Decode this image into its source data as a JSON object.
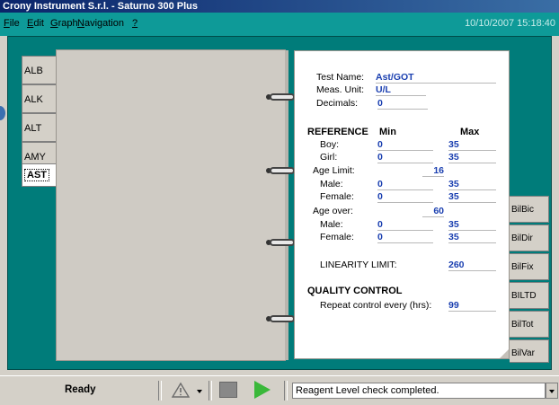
{
  "window": {
    "title": "Crony Instrument S.r.l. - Saturno 300 Plus",
    "datetime": "10/10/2007  15:18:40"
  },
  "menu": [
    {
      "label": "File",
      "key": "F"
    },
    {
      "label": "Edit",
      "key": "E"
    },
    {
      "label": "Graph",
      "key": "G"
    },
    {
      "label": "Navigation",
      "key": "N"
    },
    {
      "label": "?",
      "key": "?"
    }
  ],
  "left_tabs": [
    "ALB",
    "ALK",
    "ALT",
    "AMY",
    "AST"
  ],
  "active_tab": "AST",
  "right_tabs": [
    "BilBic",
    "BilDir",
    "BilFix",
    "BILTD",
    "BilTot",
    "BilVar"
  ],
  "form": {
    "test_name_label": "Test Name:",
    "test_name": "Ast/GOT",
    "unit_label": "Meas. Unit:",
    "unit": "U/L",
    "decimals_label": "Decimals:",
    "decimals": "0",
    "reference_header": "REFERENCE",
    "min_header": "Min",
    "max_header": "Max",
    "boy_label": "Boy:",
    "boy_min": "0",
    "boy_max": "35",
    "girl_label": "Girl:",
    "girl_min": "0",
    "girl_max": "35",
    "age_limit_label": "Age Limit:",
    "age_limit": "16",
    "male1_label": "Male:",
    "male1_min": "0",
    "male1_max": "35",
    "female1_label": "Female:",
    "female1_min": "0",
    "female1_max": "35",
    "age_over_label": "Age over:",
    "age_over": "60",
    "male2_label": "Male:",
    "male2_min": "0",
    "male2_max": "35",
    "female2_label": "Female:",
    "female2_min": "0",
    "female2_max": "35",
    "linearity_label": "LINEARITY LIMIT:",
    "linearity": "260",
    "qc_header": "QUALITY CONTROL",
    "repeat_label": "Repeat control every (hrs):",
    "repeat": "99"
  },
  "status": {
    "state": "Ready",
    "message": "Reagent Level check completed."
  },
  "colors": {
    "frame": "#007c7a",
    "menubar": "#0e9a98",
    "value_text": "#1a3fb0",
    "play": "#3ab83a"
  }
}
